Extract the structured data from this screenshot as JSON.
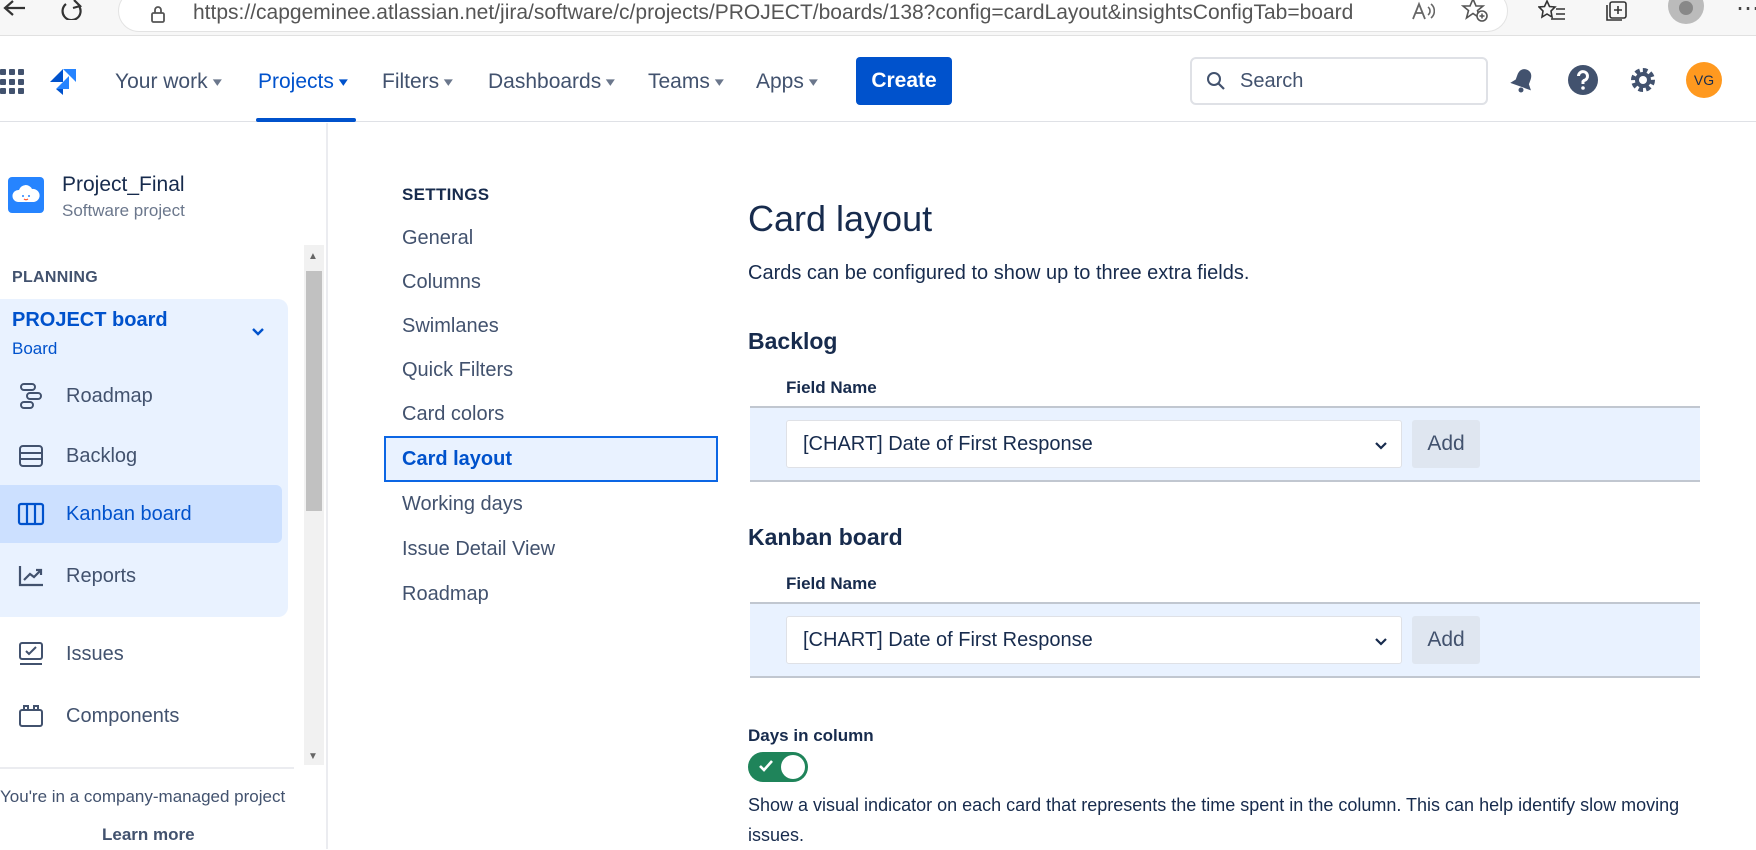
{
  "browser": {
    "url": "https://capgeminee.atlassian.net/jira/software/c/projects/PROJECT/boards/138?config=cardLayout&insightsConfigTab=board",
    "read_aloud": "Ă"
  },
  "topnav": {
    "items": [
      {
        "label": "Your work"
      },
      {
        "label": "Projects"
      },
      {
        "label": "Filters"
      },
      {
        "label": "Dashboards"
      },
      {
        "label": "Teams"
      },
      {
        "label": "Apps"
      }
    ],
    "create_label": "Create",
    "search_placeholder": "Search",
    "avatar_initials": "VG",
    "accent_color": "#0052cc"
  },
  "sidebar": {
    "project_name": "Project_Final",
    "project_type": "Software project",
    "planning_heading": "PLANNING",
    "board_title": "PROJECT board",
    "board_subtitle": "Board",
    "items": [
      {
        "label": "Roadmap"
      },
      {
        "label": "Backlog"
      },
      {
        "label": "Kanban board"
      },
      {
        "label": "Reports"
      },
      {
        "label": "Issues"
      },
      {
        "label": "Components"
      }
    ],
    "company_note": "You're in a company-managed project",
    "learn_more": "Learn more"
  },
  "settings": {
    "heading": "SETTINGS",
    "items": [
      {
        "label": "General"
      },
      {
        "label": "Columns"
      },
      {
        "label": "Swimlanes"
      },
      {
        "label": "Quick Filters"
      },
      {
        "label": "Card colors"
      },
      {
        "label": "Card layout"
      },
      {
        "label": "Working days"
      },
      {
        "label": "Issue Detail View"
      },
      {
        "label": "Roadmap"
      }
    ]
  },
  "main": {
    "title": "Card layout",
    "description": "Cards can be configured to show up to three extra fields.",
    "backlog": {
      "title": "Backlog",
      "field_label": "Field Name",
      "selected": "[CHART] Date of First Response",
      "add_label": "Add"
    },
    "kanban": {
      "title": "Kanban board",
      "field_label": "Field Name",
      "selected": "[CHART] Date of First Response",
      "add_label": "Add"
    },
    "days_in_column": {
      "label": "Days in column",
      "enabled": true,
      "description": "Show a visual indicator on each card that represents the time spent in the column. This can help identify slow moving issues."
    }
  }
}
